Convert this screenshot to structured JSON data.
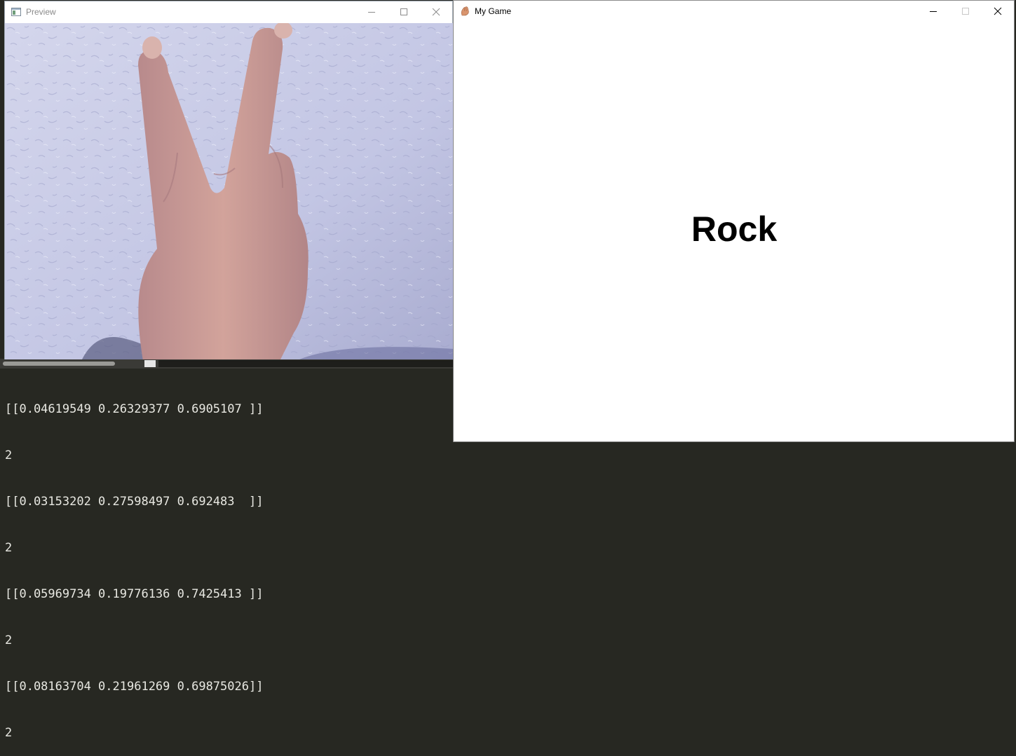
{
  "preview_window": {
    "title": "Preview",
    "title_icon": "app-window-icon",
    "controls": [
      "minimize-icon",
      "maximize-icon",
      "close-icon"
    ],
    "camera_feed": "webcam-hand-peace-sign"
  },
  "game_window": {
    "title": "My Game",
    "title_icon": "hand-icon",
    "controls": [
      "minimize-icon",
      "maximize-icon",
      "close-icon"
    ],
    "result_text": "Rock"
  },
  "terminal": {
    "lines": [
      "[[0.04619549 0.26329377 0.6905107 ]]",
      "2",
      "[[0.03153202 0.27598497 0.692483  ]]",
      "2",
      "[[0.05969734 0.19776136 0.7425413 ]]",
      "2",
      "[[0.08163704 0.21961269 0.69875026]]",
      "2"
    ]
  },
  "colors": {
    "terminal_bg": "#272822",
    "terminal_text": "#e8e8e2",
    "window_bg": "#ffffff",
    "wall": "#c9cce6",
    "skin": "#c99891"
  }
}
